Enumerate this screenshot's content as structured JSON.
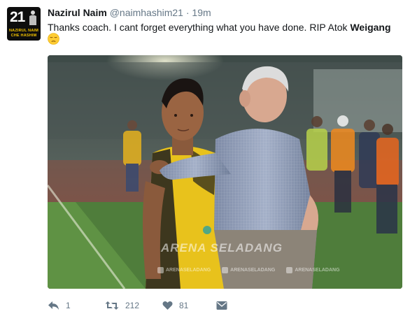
{
  "user": {
    "avatar_number": "21",
    "avatar_line1": "NAZIRUL NAIM",
    "avatar_line2": "CHE HASHIM",
    "name": "Nazirul Naim",
    "handle": "@naimhashim21",
    "separator": "·",
    "time": "19m"
  },
  "tweet": {
    "text_main": "Thanks coach. I cant forget everything what you have done. RIP Atok ",
    "text_bold": "Weigang",
    "emoji": "pensive-face"
  },
  "media": {
    "watermark": "ARENA SELADANG",
    "watermark_links": [
      "ARENASELADANG",
      "ARENASELADANG",
      "ARENASELADANG"
    ]
  },
  "actions": {
    "reply_count": "1",
    "retweet_count": "212",
    "like_count": "81"
  },
  "colors": {
    "text": "#14171a",
    "secondary": "#657786",
    "jersey_yellow": "#e8c21c"
  }
}
